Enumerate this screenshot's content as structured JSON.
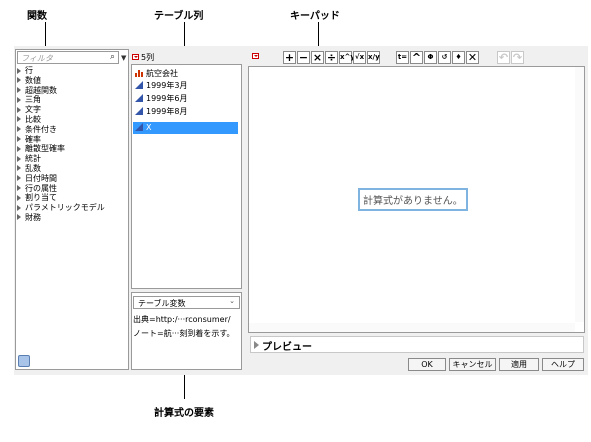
{
  "callouts": {
    "functions": "関数",
    "table_columns": "テーブル列",
    "keypad": "キーパッド",
    "formula_elements": "計算式の要素"
  },
  "filter": {
    "placeholder": "フィルタ"
  },
  "functions": [
    "行",
    "数値",
    "超越関数",
    "三角",
    "文字",
    "比較",
    "条件付き",
    "確率",
    "離散型確率",
    "統計",
    "乱数",
    "日付時間",
    "行の属性",
    "割り当て",
    "パラメトリックモデル",
    "財務"
  ],
  "columns": {
    "count_label": "5列",
    "items": [
      {
        "label": "航空会社",
        "icon": "nominal-column-icon",
        "selected": false
      },
      {
        "label": "1999年3月",
        "icon": "continuous-column-icon",
        "selected": false
      },
      {
        "label": "1999年6月",
        "icon": "continuous-column-icon",
        "selected": false
      },
      {
        "label": "1999年8月",
        "icon": "continuous-column-icon",
        "selected": false
      },
      {
        "label": "X",
        "icon": "continuous-column-icon",
        "selected": true
      }
    ]
  },
  "table_vars": {
    "dropdown_label": "テーブル変数",
    "lines": [
      "出典=http:/···rconsumer/",
      "ノート=航···刻到着を示す。"
    ]
  },
  "keypad": {
    "buttons": [
      "+",
      "−",
      "×",
      "÷",
      "x^y",
      "√x",
      "x/y"
    ],
    "buttons2": [
      "t=",
      "^",
      "Φ",
      "↺",
      "♦",
      "✕"
    ],
    "undo": "↶",
    "redo": "↷"
  },
  "editor": {
    "empty_message": "計算式がありません。"
  },
  "preview": {
    "label": "プレビュー"
  },
  "buttons": {
    "ok": "OK",
    "cancel": "キャンセル",
    "apply": "適用",
    "help": "ヘルプ"
  },
  "colors": {
    "selection": "#3399ff",
    "accent_red": "#cc0000",
    "column_blue": "#3355aa",
    "nominal_red": "#cc3300"
  }
}
